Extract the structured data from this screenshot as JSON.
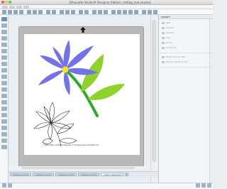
{
  "window": {
    "title": "Silhouette Studio® Designer Edition: cutting_mat.studio3"
  },
  "right_panel": {
    "title": "MODIFY",
    "sections": [
      {
        "label": "Weld"
      },
      {
        "label": "Subtract"
      },
      {
        "label": "Intersect"
      },
      {
        "label": "Crop"
      },
      {
        "label": "Divide"
      },
      {
        "label": "Subtract All"
      },
      {
        "label": "Make Compound Path"
      },
      {
        "label": "Release Compound Path"
      }
    ]
  },
  "canvas": {
    "copyright": "© 2012 Mary Carlotta's Republic © Thread www.mcarlotta.com",
    "flower_color": "#7472e8",
    "center_color": "#f2e617",
    "stem_color": "#2ea82e",
    "leaf_color": "#8fd12d",
    "mat_color": "#b9b9b9"
  },
  "tabs": [
    {
      "label": "Untitled-1.studio3"
    },
    {
      "label": "Untitled-2.studio3"
    },
    {
      "label": "Untitled-3.studio3"
    },
    {
      "label": "Untitled-4.studio3"
    },
    {
      "label": "cutting_mat.studio3"
    }
  ]
}
